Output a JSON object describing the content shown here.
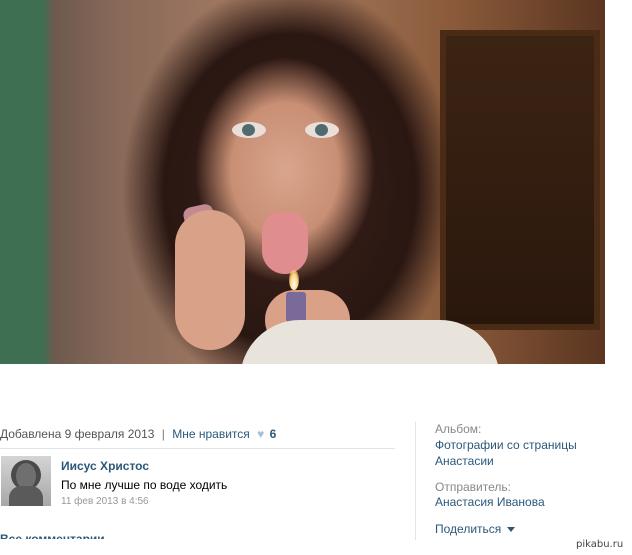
{
  "post": {
    "added": "Добавлена 9 февраля 2013",
    "separator": "|",
    "like_label": "Мне нравится",
    "like_count": "6"
  },
  "comment": {
    "author": "Иисус Христос",
    "text": "По мне лучше по воде ходить",
    "date": "11 фев 2013 в 4:56"
  },
  "all_comments": "Все комментарии",
  "sidebar": {
    "album_label": "Альбом:",
    "album_link_line1": "Фотографии со страницы",
    "album_link_line2": "Анастасии",
    "sender_label": "Отправитель:",
    "sender_name": "Анастасия Иванова",
    "share": "Поделиться"
  },
  "watermark": "pikabu.ru",
  "colors": {
    "link": "#2b587a",
    "muted": "#555555",
    "divider": "#dfe5eb"
  },
  "icons": {
    "like": "heart-icon",
    "share": "chevron-down-icon"
  }
}
